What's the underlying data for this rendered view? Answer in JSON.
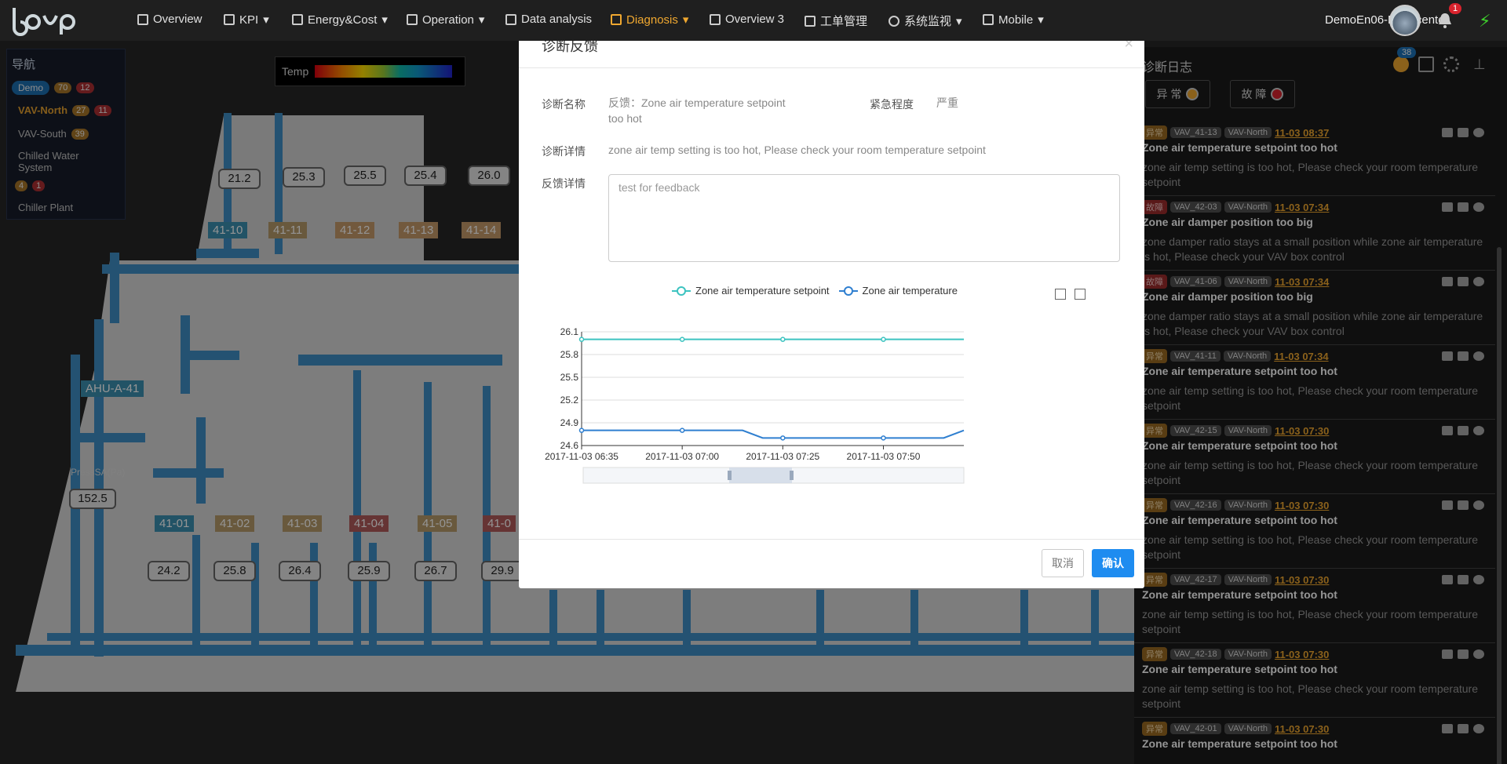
{
  "topnav": {
    "items": [
      "Overview",
      "KPI",
      "Energy&Cost",
      "Operation",
      "Data analysis",
      "Diagnosis",
      "Overview 3",
      "工单管理",
      "系统监视",
      "Mobile"
    ],
    "user": "DemoEn06-R&D center",
    "notif_count": "1"
  },
  "nav": {
    "title": "导航",
    "items": [
      {
        "label": "Demo",
        "c1": "70",
        "c2": "12"
      },
      {
        "label": "VAV-North",
        "c1": "27",
        "c2": "11"
      },
      {
        "label": "VAV-South",
        "c1": "39"
      },
      {
        "label": "Chilled Water System",
        "c1": "4",
        "c2": "1"
      },
      {
        "label": "Chiller Plant"
      }
    ]
  },
  "scene": {
    "legend_label": "Temp",
    "temps_top": [
      "21.2",
      "25.3",
      "25.5",
      "25.4",
      "26.0"
    ],
    "zones_top": [
      "41-10",
      "41-11",
      "41-12",
      "41-13",
      "41-14"
    ],
    "ahu": "AHU-A-41",
    "press_label": "PressSA(Pa)",
    "press_value": "152.5",
    "zones_bottom": [
      "41-01",
      "41-02",
      "41-03",
      "41-04",
      "41-05",
      "41-0"
    ],
    "temps_bottom": [
      "24.2",
      "25.8",
      "26.4",
      "25.9",
      "26.7",
      "29.9"
    ]
  },
  "log": {
    "title": "诊断日志",
    "badge": "38",
    "filter_abnormal": "异 常",
    "filter_fault": "故 障",
    "items": [
      {
        "tag": "异常",
        "type": "warn",
        "dev": "VAV_41-13",
        "area": "VAV-North",
        "time": "11-03 08:37",
        "title": "Zone air temperature setpoint too hot",
        "desc": "zone air temp setting is too hot, Please check your room temperature setpoint"
      },
      {
        "tag": "故障",
        "type": "fault",
        "dev": "VAV_42-03",
        "area": "VAV-North",
        "time": "11-03 07:34",
        "title": "Zone air damper position too big",
        "desc": "zone damper ratio stays at a small position while zone air temperature is hot, Please check your VAV box control"
      },
      {
        "tag": "故障",
        "type": "fault",
        "dev": "VAV_41-06",
        "area": "VAV-North",
        "time": "11-03 07:34",
        "title": "Zone air damper position too big",
        "desc": "zone damper ratio stays at a small position while zone air temperature is hot, Please check your VAV box control"
      },
      {
        "tag": "异常",
        "type": "warn",
        "dev": "VAV_41-11",
        "area": "VAV-North",
        "time": "11-03 07:34",
        "title": "Zone air temperature setpoint too hot",
        "desc": "zone air temp setting is too hot, Please check your room temperature setpoint"
      },
      {
        "tag": "异常",
        "type": "warn",
        "dev": "VAV_42-15",
        "area": "VAV-North",
        "time": "11-03 07:30",
        "title": "Zone air temperature setpoint too hot",
        "desc": "zone air temp setting is too hot, Please check your room temperature setpoint"
      },
      {
        "tag": "异常",
        "type": "warn",
        "dev": "VAV_42-16",
        "area": "VAV-North",
        "time": "11-03 07:30",
        "title": "Zone air temperature setpoint too hot",
        "desc": "zone air temp setting is too hot, Please check your room temperature setpoint"
      },
      {
        "tag": "异常",
        "type": "warn",
        "dev": "VAV_42-17",
        "area": "VAV-North",
        "time": "11-03 07:30",
        "title": "Zone air temperature setpoint too hot",
        "desc": "zone air temp setting is too hot, Please check your room temperature setpoint"
      },
      {
        "tag": "异常",
        "type": "warn",
        "dev": "VAV_42-18",
        "area": "VAV-North",
        "time": "11-03 07:30",
        "title": "Zone air temperature setpoint too hot",
        "desc": "zone air temp setting is too hot, Please check your room temperature setpoint"
      },
      {
        "tag": "异常",
        "type": "warn",
        "dev": "VAV_42-01",
        "area": "VAV-North",
        "time": "11-03 07:30",
        "title": "Zone air temperature setpoint too hot",
        "desc": ""
      }
    ]
  },
  "modal": {
    "title": "诊断反馈",
    "close": "×",
    "name_label": "诊断名称",
    "name_value": "反馈：Zone air temperature setpoint too hot",
    "urgency_label": "紧急程度",
    "urgency_value": "严重",
    "detail_label": "诊断详情",
    "detail_value": "zone air temp setting is too hot, Please check your room temperature setpoint",
    "feedback_label": "反馈详情",
    "feedback_value": "test for feedback",
    "cancel": "取消",
    "confirm": "确认"
  },
  "chart_data": {
    "type": "line",
    "x": [
      "2017-11-03 06:35",
      "2017-11-03 06:40",
      "2017-11-03 06:45",
      "2017-11-03 06:50",
      "2017-11-03 06:55",
      "2017-11-03 07:00",
      "2017-11-03 07:05",
      "2017-11-03 07:10",
      "2017-11-03 07:15",
      "2017-11-03 07:20",
      "2017-11-03 07:25",
      "2017-11-03 07:30",
      "2017-11-03 07:35",
      "2017-11-03 07:40",
      "2017-11-03 07:45",
      "2017-11-03 07:50",
      "2017-11-03 07:55",
      "2017-11-03 08:00",
      "2017-11-03 08:05",
      "2017-11-03 08:10"
    ],
    "xticks": [
      "2017-11-03 06:35",
      "2017-11-03 07:00",
      "2017-11-03 07:25",
      "2017-11-03 07:50"
    ],
    "series": [
      {
        "name": "Zone air temperature setpoint",
        "color": "#3cc3c0",
        "values": [
          26.0,
          26.0,
          26.0,
          26.0,
          26.0,
          26.0,
          26.0,
          26.0,
          26.0,
          26.0,
          26.0,
          26.0,
          26.0,
          26.0,
          26.0,
          26.0,
          26.0,
          26.0,
          26.0,
          26.0
        ]
      },
      {
        "name": "Zone air temperature",
        "color": "#2f7fd0",
        "values": [
          24.8,
          24.8,
          24.8,
          24.8,
          24.8,
          24.8,
          24.8,
          24.8,
          24.8,
          24.7,
          24.7,
          24.7,
          24.7,
          24.7,
          24.7,
          24.7,
          24.7,
          24.7,
          24.7,
          24.8
        ]
      }
    ],
    "yticks": [
      24.6,
      24.9,
      25.2,
      25.5,
      25.8,
      26.1
    ],
    "ylim": [
      24.6,
      26.1
    ],
    "grid": true,
    "legend": "top"
  }
}
